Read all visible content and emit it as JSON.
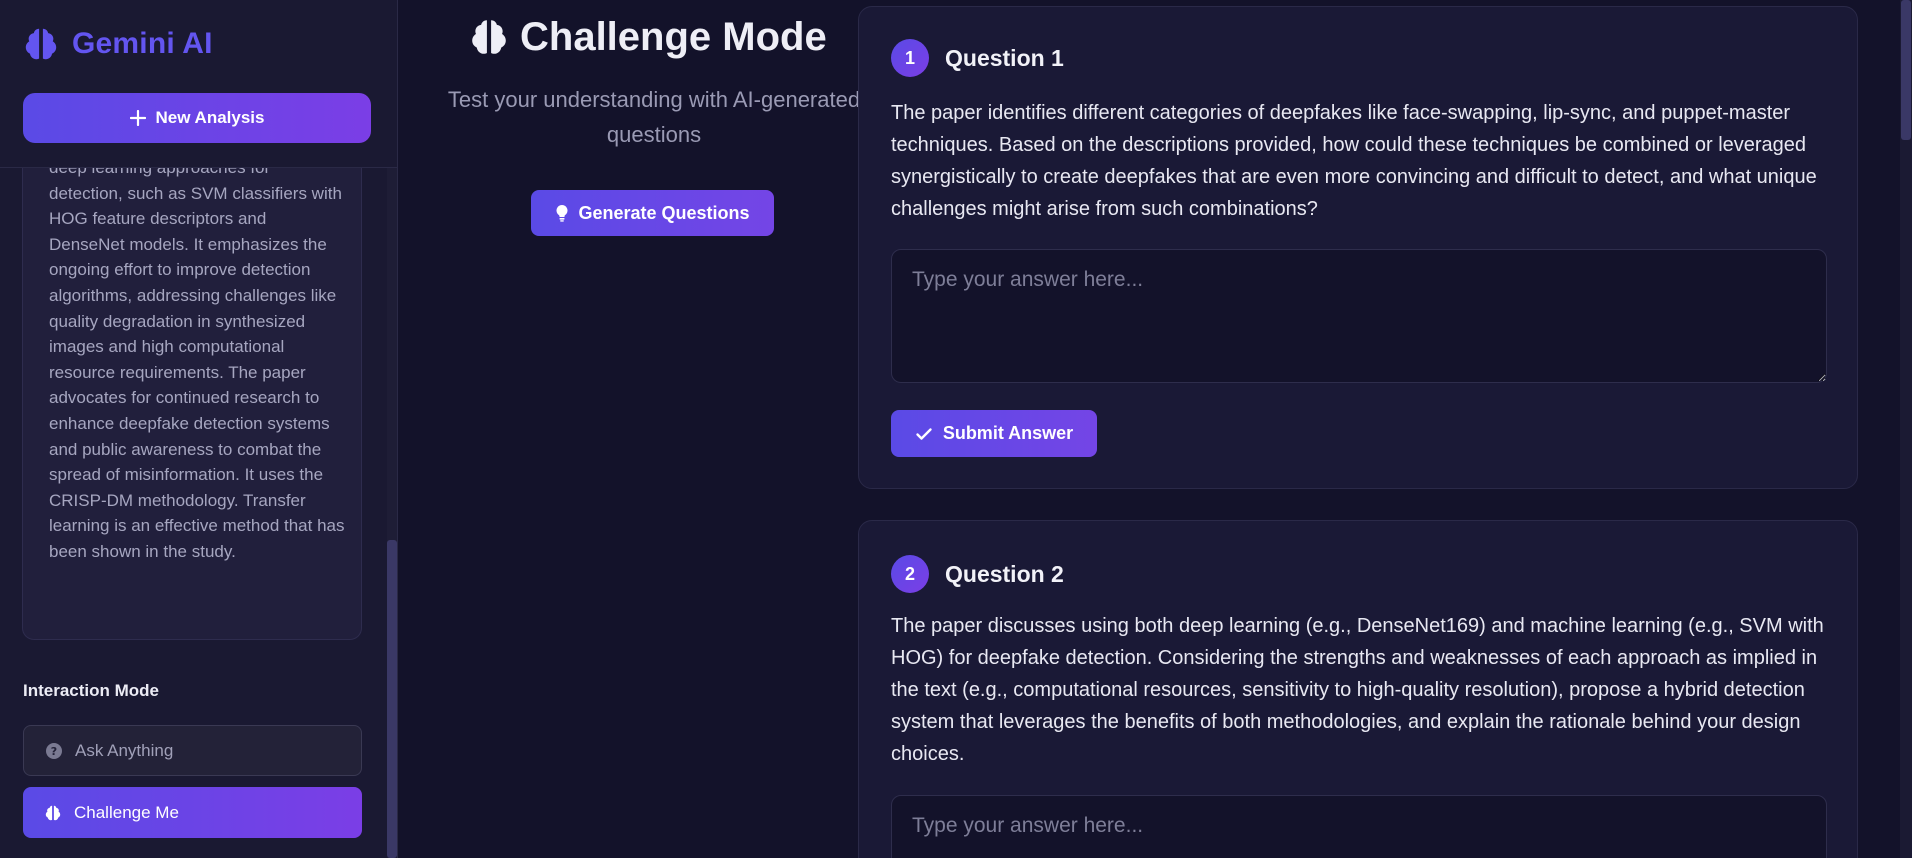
{
  "sidebar": {
    "brand": {
      "name": "Gemini AI",
      "icon": "brain-icon",
      "color": "#6355f0"
    },
    "new_analysis_label": "New Analysis",
    "summary_text": "deep learning approaches for detection, such as SVM classifiers with HOG feature descriptors and DenseNet models. It emphasizes the ongoing effort to improve detection algorithms, addressing challenges like quality degradation in synthesized images and high computational resource requirements. The paper advocates for continued research to enhance deepfake detection systems and public awareness to combat the spread of misinformation. It uses the CRISP-DM methodology. Transfer learning is an effective method that has been shown in the study.",
    "interaction_mode": {
      "heading": "Interaction Mode",
      "options": [
        {
          "label": "Ask Anything",
          "icon": "question-icon",
          "active": false
        },
        {
          "label": "Challenge Me",
          "icon": "brain-icon",
          "active": true
        }
      ]
    }
  },
  "main": {
    "title": "Challenge Mode",
    "subtitle": "Test your understanding with AI-generated questions",
    "generate_label": "Generate Questions",
    "accent": "#5a4ae6",
    "questions": [
      {
        "number": "1",
        "title": "Question 1",
        "text": "The paper identifies different categories of deepfakes like face-swapping, lip-sync, and puppet-master techniques. Based on the descriptions provided, how could these techniques be combined or leveraged synergistically to create deepfakes that are even more convincing and difficult to detect, and what unique challenges might arise from such combinations?",
        "answer_placeholder": "Type your answer here...",
        "submit_label": "Submit Answer"
      },
      {
        "number": "2",
        "title": "Question 2",
        "text": "The paper discusses using both deep learning (e.g., DenseNet169) and machine learning (e.g., SVM with HOG) for deepfake detection. Considering the strengths and weaknesses of each approach as implied in the text (e.g., computational resources, sensitivity to high-quality resolution), propose a hybrid detection system that leverages the benefits of both methodologies, and explain the rationale behind your design choices.",
        "answer_placeholder": "Type your answer here..."
      }
    ]
  }
}
